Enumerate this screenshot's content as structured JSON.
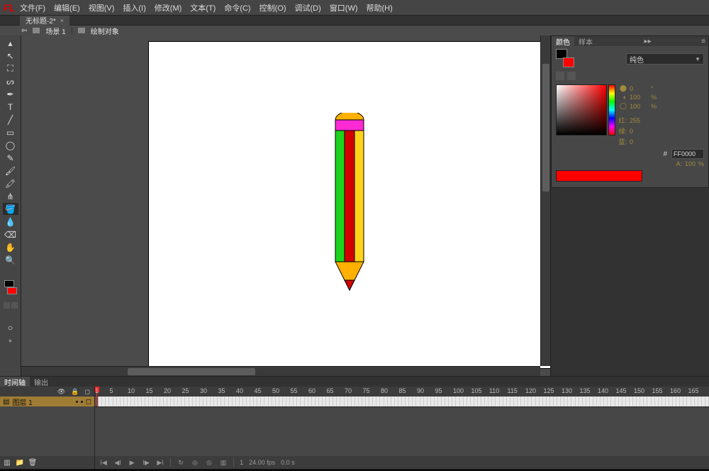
{
  "app_icon": "FL",
  "menus": [
    "文件(F)",
    "编辑(E)",
    "视图(V)",
    "插入(I)",
    "修改(M)",
    "文本(T)",
    "命令(C)",
    "控制(O)",
    "调试(D)",
    "窗口(W)",
    "帮助(H)"
  ],
  "document": {
    "tab_title": "无标题-2*",
    "close_glyph": "×"
  },
  "scene_bar": {
    "scene_label": "场景 1",
    "object_label": "绘制对象",
    "back_glyph": "⇦"
  },
  "tools": {
    "items": [
      {
        "name": "selection-tool",
        "glyph": "▴",
        "sel": false
      },
      {
        "name": "subselection-tool",
        "glyph": "↖",
        "sel": false
      },
      {
        "name": "free-transform-tool",
        "glyph": "⛶",
        "sel": false
      },
      {
        "name": "lasso-tool",
        "glyph": "ᔕ",
        "sel": false
      },
      {
        "name": "pen-tool",
        "glyph": "✒",
        "sel": false
      },
      {
        "name": "text-tool",
        "glyph": "T",
        "sel": false
      },
      {
        "name": "line-tool",
        "glyph": "╱",
        "sel": false
      },
      {
        "name": "rectangle-tool",
        "glyph": "▭",
        "sel": false
      },
      {
        "name": "oval-tool",
        "glyph": "◯",
        "sel": false
      },
      {
        "name": "pencil-tool",
        "glyph": "✎",
        "sel": false
      },
      {
        "name": "brush-tool",
        "glyph": "🖌",
        "sel": false
      },
      {
        "name": "deco-tool",
        "glyph": "🖍",
        "sel": false
      },
      {
        "name": "bone-tool",
        "glyph": "⋔",
        "sel": false
      },
      {
        "name": "paint-bucket-tool",
        "glyph": "🪣",
        "sel": true
      },
      {
        "name": "eyedropper-tool",
        "glyph": "💧",
        "sel": false
      },
      {
        "name": "eraser-tool",
        "glyph": "⌫",
        "sel": false
      },
      {
        "name": "hand-tool",
        "glyph": "✋",
        "sel": false
      },
      {
        "name": "zoom-tool",
        "glyph": "🔍",
        "sel": false
      }
    ]
  },
  "color_panel": {
    "tab_color": "颜色",
    "tab_swatches": "样本",
    "fill_type": "纯色",
    "hsv": {
      "h": "0",
      "s": "100",
      "v": "100"
    },
    "unit_deg": "°",
    "unit_pct": "%",
    "rgb": {
      "r_label": "红:",
      "g_label": "绿:",
      "b_label": "蓝:",
      "r": "255",
      "g": "0",
      "b": "0"
    },
    "hex_label": "#",
    "hex_value": "FF0000",
    "alpha_label": "A:",
    "alpha_value": "100",
    "alpha_unit": "%"
  },
  "timeline": {
    "tab_timeline": "时间轴",
    "tab_output": "输出",
    "layer_name": "图层 1",
    "ruler_marks": [
      1,
      5,
      10,
      15,
      20,
      25,
      30,
      35,
      40,
      45,
      50,
      55,
      60,
      65,
      70,
      75,
      80,
      85,
      90,
      95,
      100,
      105,
      110,
      115,
      120,
      125,
      130,
      135,
      140,
      145,
      150,
      155,
      160,
      165
    ],
    "status": {
      "fps": "24.00 fps",
      "time": "0.0 s",
      "frame_num": "1"
    }
  }
}
